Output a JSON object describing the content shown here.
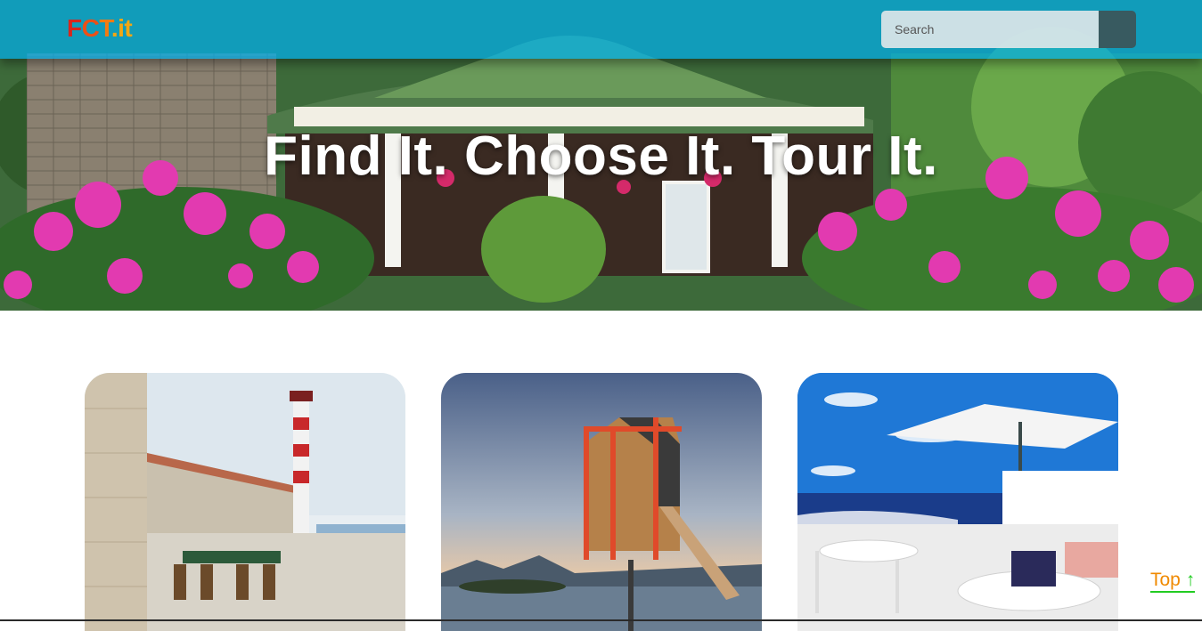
{
  "navbar": {
    "logo": {
      "part1": "F",
      "part2": "C",
      "part3": "T",
      "part4": ".it"
    },
    "search": {
      "placeholder": "Search",
      "button_icon": "search-icon"
    }
  },
  "hero": {
    "headline": "Find It. Choose It. Tour It."
  },
  "cards": [
    {
      "image": "lighthouse-terrace-photo"
    },
    {
      "image": "stilted-cabin-photo"
    },
    {
      "image": "seaside-patio-photo"
    }
  ],
  "top_link": {
    "label": "Top",
    "arrow": "↑"
  },
  "colors": {
    "navbar": "#00b0eb",
    "logo_red": "#d8261d",
    "logo_orange": "#f37b13",
    "top_link": "#f08a00",
    "top_underline": "#22cc22"
  }
}
